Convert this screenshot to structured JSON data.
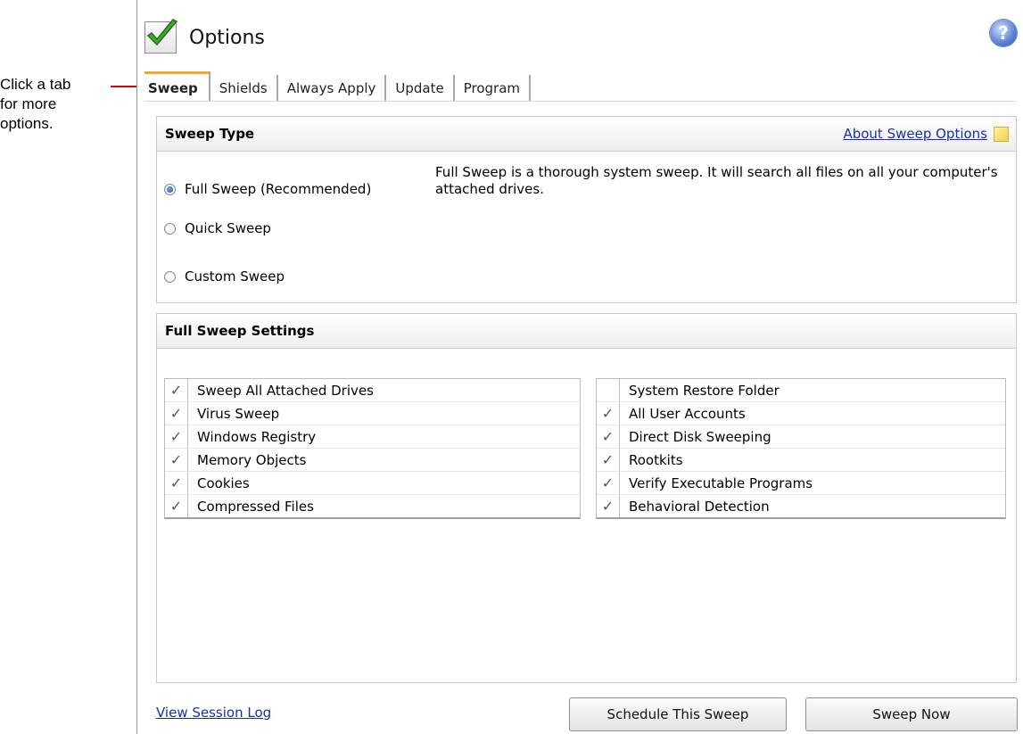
{
  "callout": {
    "lines": [
      "Click a tab",
      "for more",
      "options."
    ]
  },
  "header": {
    "title": "Options",
    "help_glyph": "?"
  },
  "tabs": [
    {
      "label": "Sweep",
      "active": true
    },
    {
      "label": "Shields",
      "active": false
    },
    {
      "label": "Always Apply",
      "active": false
    },
    {
      "label": "Update",
      "active": false
    },
    {
      "label": "Program",
      "active": false
    }
  ],
  "sweep_type": {
    "heading": "Sweep Type",
    "about_link": "About Sweep Options",
    "options": [
      {
        "label": "Full Sweep (Recommended)",
        "checked": true
      },
      {
        "label": "Quick Sweep",
        "checked": false
      },
      {
        "label": "Custom Sweep",
        "checked": false
      }
    ],
    "description": "Full Sweep is a thorough system sweep. It will search all files on all your computer's attached drives."
  },
  "settings": {
    "heading": "Full Sweep Settings",
    "left": [
      {
        "label": "Sweep All Attached Drives",
        "checked": true
      },
      {
        "label": "Virus Sweep",
        "checked": true
      },
      {
        "label": "Windows Registry",
        "checked": true
      },
      {
        "label": "Memory Objects",
        "checked": true
      },
      {
        "label": "Cookies",
        "checked": true
      },
      {
        "label": "Compressed Files",
        "checked": true
      }
    ],
    "right": [
      {
        "label": "System Restore Folder",
        "checked": false
      },
      {
        "label": "All User Accounts",
        "checked": true
      },
      {
        "label": "Direct Disk Sweeping",
        "checked": true
      },
      {
        "label": "Rootkits",
        "checked": true
      },
      {
        "label": "Verify Executable Programs",
        "checked": true
      },
      {
        "label": "Behavioral Detection",
        "checked": true
      }
    ]
  },
  "footer": {
    "view_log": "View Session Log",
    "schedule_button": "Schedule This Sweep",
    "sweep_now_button": "Sweep Now"
  },
  "colors": {
    "link": "#1a2fb0",
    "active_tab_accent": "#f0a830",
    "callout_arrow": "#e00000"
  }
}
